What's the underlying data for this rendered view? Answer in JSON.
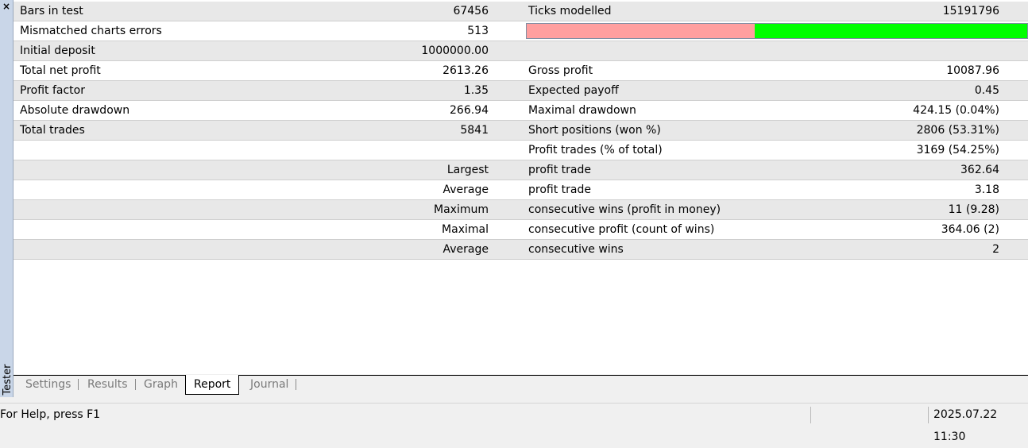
{
  "panel": {
    "close_icon": "×",
    "side_label": "Tester"
  },
  "report": {
    "rows": [
      {
        "l_label": "Bars in test",
        "l_value": "67456",
        "r_label": "Ticks modelled",
        "r_value": "15191796"
      },
      {
        "l_label": "Mismatched charts errors",
        "l_value": "513",
        "r_label": "",
        "r_value": ""
      },
      {
        "l_label": "Initial deposit",
        "l_value": "1000000.00",
        "r_label": "",
        "r_value": ""
      },
      {
        "l_label": "Total net profit",
        "l_value": "2613.26",
        "r_label": "Gross profit",
        "r_value": "10087.96"
      },
      {
        "l_label": "Profit factor",
        "l_value": "1.35",
        "r_label": "Expected payoff",
        "r_value": "0.45"
      },
      {
        "l_label": "Absolute drawdown",
        "l_value": "266.94",
        "r_label": "Maximal drawdown",
        "r_value": "424.15 (0.04%)"
      },
      {
        "l_label": "Total trades",
        "l_value": "5841",
        "r_label": "Short positions (won %)",
        "r_value": "2806 (53.31%)"
      },
      {
        "l_label": "",
        "l_value": "",
        "r_label": "Profit trades (% of total)",
        "r_value": "3169 (54.25%)"
      },
      {
        "l_label": "",
        "l_value": "Largest",
        "r_label": "profit trade",
        "r_value": "362.64"
      },
      {
        "l_label": "",
        "l_value": "Average",
        "r_label": "profit trade",
        "r_value": "3.18"
      },
      {
        "l_label": "",
        "l_value": "Maximum",
        "r_label": "consecutive wins (profit in money)",
        "r_value": "11 (9.28)"
      },
      {
        "l_label": "",
        "l_value": "Maximal",
        "r_label": "consecutive profit (count of wins)",
        "r_value": "364.06 (2)"
      },
      {
        "l_label": "",
        "l_value": "Average",
        "r_label": "consecutive wins",
        "r_value": "2"
      }
    ],
    "quality_bar": {
      "red_fraction": 0.455,
      "red_color": "#ff9f9f",
      "green_color": "#00ff00"
    }
  },
  "tabs": [
    {
      "label": "Settings",
      "active": false
    },
    {
      "label": "Results",
      "active": false
    },
    {
      "label": "Graph",
      "active": false
    },
    {
      "label": "Report",
      "active": true
    },
    {
      "label": "Journal",
      "active": false
    }
  ],
  "status": {
    "help": "For Help, press F1",
    "datetime": "2025.07.22 11:30"
  }
}
